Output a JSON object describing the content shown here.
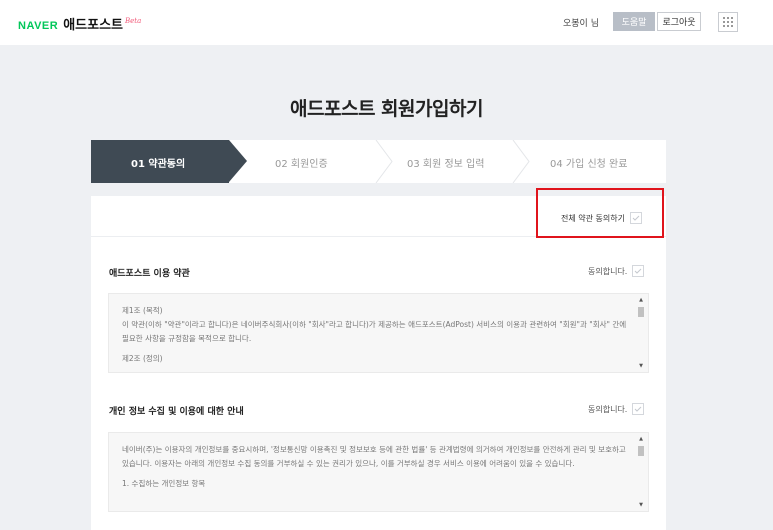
{
  "header": {
    "logo_brand": "NAVER",
    "logo_title": "애드포스트",
    "logo_badge": "Beta",
    "user_name": "오봉이 님",
    "help_label": "도움말",
    "logout_label": "로그아웃",
    "apps_icon": "apps-grid-icon"
  },
  "page_title": "애드포스트 회원가입하기",
  "steps": [
    {
      "label": "01  약관동의",
      "active": true
    },
    {
      "label": "02  회원인증",
      "active": false
    },
    {
      "label": "03  회원 정보 입력",
      "active": false
    },
    {
      "label": "04  가입 신청 완료",
      "active": false
    }
  ],
  "agree_all_label": "전체 약관 동의하기",
  "sections": [
    {
      "title": "애드포스트 이용 약관",
      "agree_label": "동의합니다.",
      "paragraphs": [
        "제1조 (목적)",
        "이 약관(이하 \"약관\"이라고 합니다)은 네이버주식회사(이하 \"회사\"라고 합니다)가 제공하는 애드포스트(AdPost) 서비스의 이용과 관련하여 \"회원\"과 \"회사\" 간에 필요한 사항을 규정함을 목적으로 합니다.",
        "제2조 (정의)"
      ]
    },
    {
      "title": "개인 정보 수집 및 이용에 대한 안내",
      "agree_label": "동의합니다.",
      "paragraphs": [
        "네이버(주)는 이용자의 개인정보를 중요시하며, '정보통신망 이용촉진 및 정보보호 등에 관한 법률' 등 관계법령에 의거하여 개인정보를 안전하게 관리 및 보호하고 있습니다. 이용자는 아래의 개인정보 수집 동의를 거부하실 수 있는 권리가 있으나, 이를 거부하실 경우 서비스 이용에 어려움이 있을 수 있습니다.",
        "1. 수집하는 개인정보 항목"
      ]
    }
  ],
  "colors": {
    "brand_green": "#03c75a",
    "active_step": "#3f4a54",
    "highlight_red": "#e0141c"
  }
}
